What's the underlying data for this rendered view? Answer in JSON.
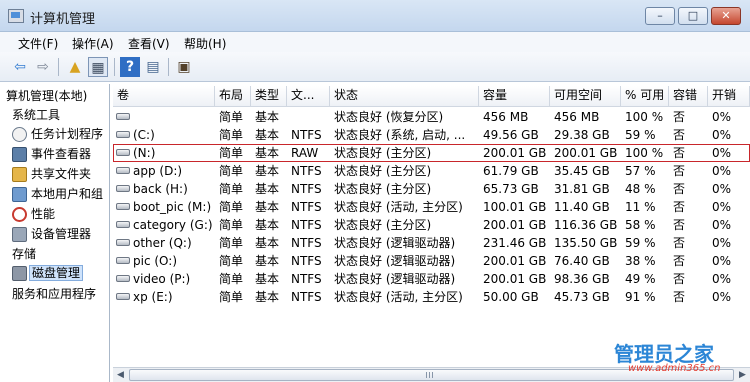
{
  "window": {
    "title": "计算机管理",
    "minimize_glyph": "–",
    "maximize_glyph": "□",
    "close_glyph": "✕"
  },
  "menu": [
    "文件(F)",
    "操作(A)",
    "查看(V)",
    "帮助(H)"
  ],
  "toolbar": {
    "back": "⇦",
    "forward": "⇨",
    "up_folder": "▲",
    "panel": "▦",
    "help": "?",
    "export": "▤",
    "properties": "▣"
  },
  "sidebar": {
    "root_label": "算机管理(本地)",
    "items": [
      {
        "label": "系统工具"
      },
      {
        "label": "任务计划程序"
      },
      {
        "label": "事件查看器"
      },
      {
        "label": "共享文件夹"
      },
      {
        "label": "本地用户和组"
      },
      {
        "label": "性能"
      },
      {
        "label": "设备管理器"
      },
      {
        "label": "存储"
      },
      {
        "label": "磁盘管理"
      },
      {
        "label": "服务和应用程序"
      }
    ]
  },
  "table": {
    "columns": [
      "卷",
      "布局",
      "类型",
      "文...",
      "状态",
      "容量",
      "可用空间",
      "% 可用",
      "容错",
      "开销"
    ],
    "rows": [
      {
        "volume": "",
        "layout": "简单",
        "type": "基本",
        "fs": "",
        "status": "状态良好 (恢复分区)",
        "capacity": "456 MB",
        "free": "456 MB",
        "pct": "100 %",
        "fault": "否",
        "overhead": "0%"
      },
      {
        "volume": "(C:)",
        "layout": "简单",
        "type": "基本",
        "fs": "NTFS",
        "status": "状态良好 (系统, 启动, ...",
        "capacity": "49.56 GB",
        "free": "29.38 GB",
        "pct": "59 %",
        "fault": "否",
        "overhead": "0%"
      },
      {
        "volume": "(N:)",
        "layout": "简单",
        "type": "基本",
        "fs": "RAW",
        "status": "状态良好 (主分区)",
        "capacity": "200.01 GB",
        "free": "200.01 GB",
        "pct": "100 %",
        "fault": "否",
        "overhead": "0%"
      },
      {
        "volume": "app (D:)",
        "layout": "简单",
        "type": "基本",
        "fs": "NTFS",
        "status": "状态良好 (主分区)",
        "capacity": "61.79 GB",
        "free": "35.45 GB",
        "pct": "57 %",
        "fault": "否",
        "overhead": "0%"
      },
      {
        "volume": "back (H:)",
        "layout": "简单",
        "type": "基本",
        "fs": "NTFS",
        "status": "状态良好 (主分区)",
        "capacity": "65.73 GB",
        "free": "31.81 GB",
        "pct": "48 %",
        "fault": "否",
        "overhead": "0%"
      },
      {
        "volume": "boot_pic (M:)",
        "layout": "简单",
        "type": "基本",
        "fs": "NTFS",
        "status": "状态良好 (活动, 主分区)",
        "capacity": "100.01 GB",
        "free": "11.40 GB",
        "pct": "11 %",
        "fault": "否",
        "overhead": "0%"
      },
      {
        "volume": "category (G:)",
        "layout": "简单",
        "type": "基本",
        "fs": "NTFS",
        "status": "状态良好 (主分区)",
        "capacity": "200.01 GB",
        "free": "116.36 GB",
        "pct": "58 %",
        "fault": "否",
        "overhead": "0%"
      },
      {
        "volume": "other (Q:)",
        "layout": "简单",
        "type": "基本",
        "fs": "NTFS",
        "status": "状态良好 (逻辑驱动器)",
        "capacity": "231.46 GB",
        "free": "135.50 GB",
        "pct": "59 %",
        "fault": "否",
        "overhead": "0%"
      },
      {
        "volume": "pic (O:)",
        "layout": "简单",
        "type": "基本",
        "fs": "NTFS",
        "status": "状态良好 (逻辑驱动器)",
        "capacity": "200.01 GB",
        "free": "76.40 GB",
        "pct": "38 %",
        "fault": "否",
        "overhead": "0%"
      },
      {
        "volume": "video (P:)",
        "layout": "简单",
        "type": "基本",
        "fs": "NTFS",
        "status": "状态良好 (逻辑驱动器)",
        "capacity": "200.01 GB",
        "free": "98.36 GB",
        "pct": "49 %",
        "fault": "否",
        "overhead": "0%"
      },
      {
        "volume": "xp (E:)",
        "layout": "简单",
        "type": "基本",
        "fs": "NTFS",
        "status": "状态良好 (活动, 主分区)",
        "capacity": "50.00 GB",
        "free": "45.73 GB",
        "pct": "91 %",
        "fault": "否",
        "overhead": "0%"
      }
    ]
  },
  "scrollbar": {
    "left_glyph": "◀",
    "right_glyph": "▶"
  },
  "watermark": {
    "title": "管理员之家",
    "url": "www.admin365.cn"
  },
  "colors": {
    "selection_outline": "#c8262b",
    "watermark_blue": "#2c86d6",
    "watermark_red": "#e23b2f"
  }
}
